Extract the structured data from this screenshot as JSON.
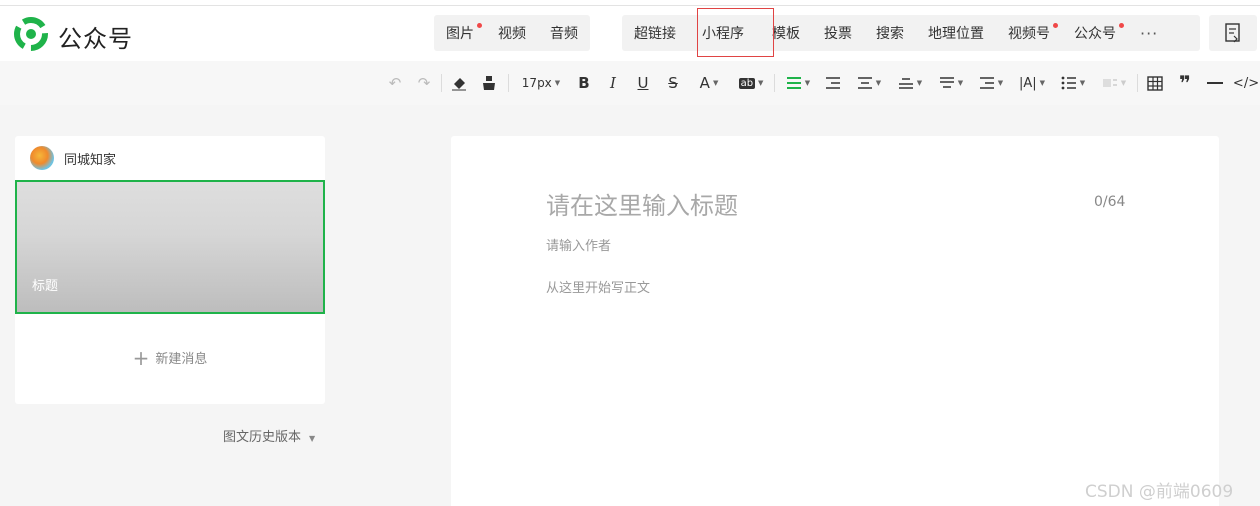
{
  "app": {
    "name": "公众号"
  },
  "insert_menu": {
    "media": [
      {
        "label": "图片",
        "dot": true
      },
      {
        "label": "视频",
        "dot": false
      },
      {
        "label": "音频",
        "dot": false
      }
    ],
    "items": [
      {
        "label": "超链接",
        "dot": false
      },
      {
        "label": "小程序",
        "dot": false,
        "highlighted": true
      },
      {
        "label": "模板",
        "dot": false
      },
      {
        "label": "投票",
        "dot": false
      },
      {
        "label": "搜索",
        "dot": false
      },
      {
        "label": "地理位置",
        "dot": false
      },
      {
        "label": "视频号",
        "dot": true
      },
      {
        "label": "公众号",
        "dot": true
      }
    ],
    "more": "···"
  },
  "toolbar": {
    "font_size": "17px"
  },
  "left_panel": {
    "account_name": "同城知家",
    "article_title": "标题",
    "new_message": "新建消息",
    "history": "图文历史版本"
  },
  "editor": {
    "title_placeholder": "请在这里输入标题",
    "title_counter": "0/64",
    "author_placeholder": "请输入作者",
    "body_placeholder": "从这里开始写正文"
  },
  "watermark": "CSDN @前端0609",
  "colors": {
    "accent": "#1fb34a",
    "highlight_box": "#e04444",
    "badge_dot": "#f04848"
  }
}
